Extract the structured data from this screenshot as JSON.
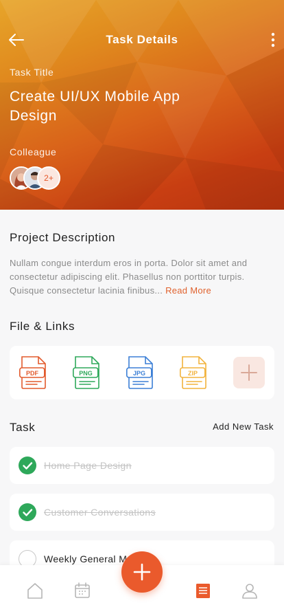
{
  "header": {
    "title": "Task Details"
  },
  "task": {
    "title_label": "Task Title",
    "title": "Create UI/UX Mobile App Design",
    "colleague_label": "Colleague",
    "colleague_more": "2+"
  },
  "description": {
    "heading": "Project Description",
    "text": "Nullam congue interdum eros in porta. Dolor sit amet and consectetur adipiscing elit. Phasellus non porttitor turpis. Quisque consectetur lacinia finibus...",
    "read_more": "Read More"
  },
  "files": {
    "heading": "File & Links",
    "items": [
      {
        "type": "PDF",
        "color": "#e25a2c"
      },
      {
        "type": "PNG",
        "color": "#2ea85a"
      },
      {
        "type": "JPG",
        "color": "#3b7fd6"
      },
      {
        "type": "ZIP",
        "color": "#f2b33d"
      }
    ],
    "add_icon": "plus-icon"
  },
  "tasks": {
    "heading": "Task",
    "add_new": "Add New Task",
    "items": [
      {
        "label": "Home Page Design",
        "done": true
      },
      {
        "label": "Customer Conversations",
        "done": true
      },
      {
        "label": "Weekly General Meeting",
        "done": false
      }
    ]
  },
  "nav": {
    "items": [
      "home-icon",
      "calendar-icon",
      "tasks-icon",
      "profile-icon"
    ],
    "active": "tasks-icon",
    "fab_icon": "plus-icon",
    "accent": "#ea5a2c"
  }
}
